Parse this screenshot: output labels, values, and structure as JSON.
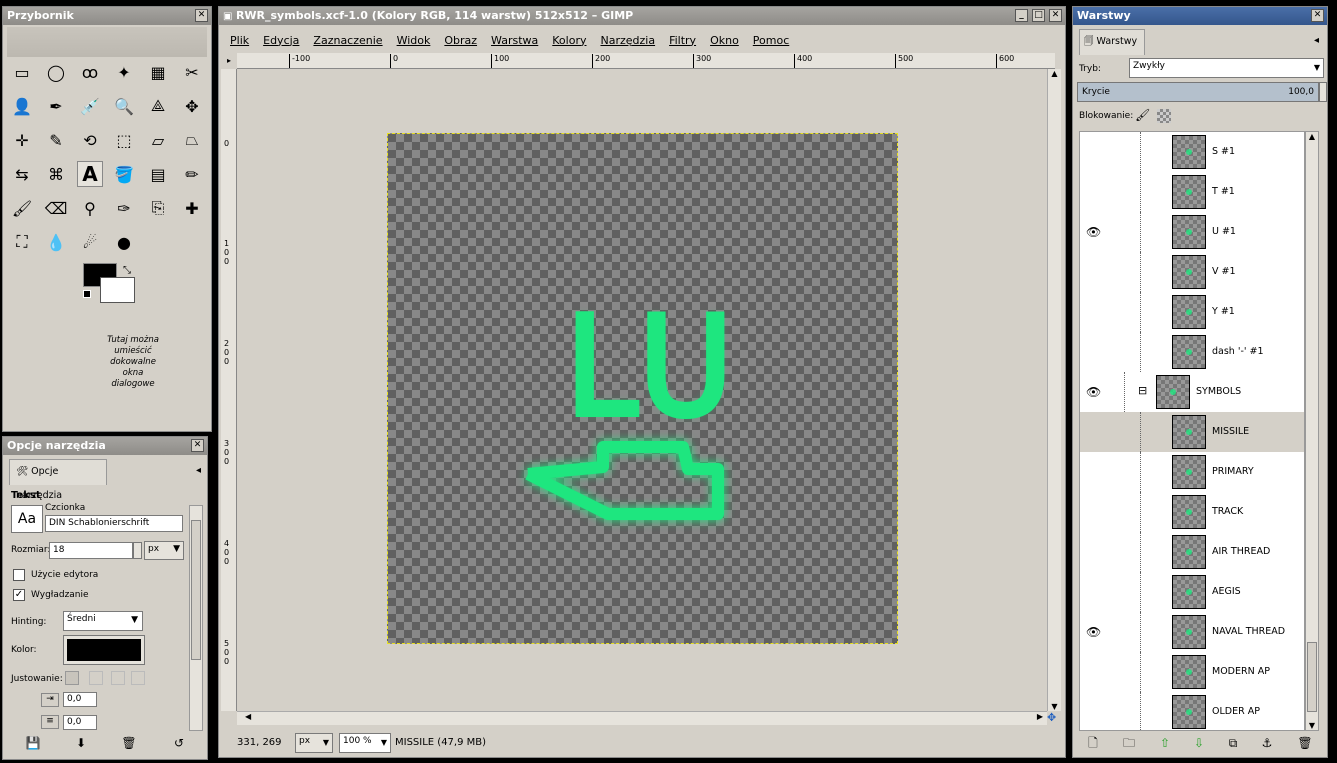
{
  "toolbox": {
    "title": "Przybornik",
    "close": "✕",
    "dock_hint": "Tutaj można umieścić dokowalne okna dialogowe"
  },
  "tool_options": {
    "title": "Opcje narzędzia",
    "tab": "Opcje narzędzia",
    "section": "Tekst",
    "font_label": "Czcionka",
    "font_value": "DIN Schablonierschrift",
    "font_preview": "Aa",
    "size_label": "Rozmiar:",
    "size_value": "18",
    "size_unit": "px",
    "editor_label": "Użycie edytora",
    "antialias_label": "Wygładzanie",
    "antialias_check": "✓",
    "hinting_label": "Hinting:",
    "hinting_value": "Średni",
    "color_label": "Kolor:",
    "justify_label": "Justowanie:",
    "indent_value": "0,0",
    "spacing_value": "0,0"
  },
  "image_window": {
    "title": "RWR_symbols.xcf-1.0 (Kolory RGB, 114 warstw) 512x512 – GIMP",
    "menu": [
      "Plik",
      "Edycja",
      "Zaznaczenie",
      "Widok",
      "Obraz",
      "Warstwa",
      "Kolory",
      "Narzędzia",
      "Filtry",
      "Okno",
      "Pomoc"
    ],
    "ruler_h": [
      "-100",
      "0",
      "100",
      "200",
      "300",
      "400",
      "500",
      "600"
    ],
    "ruler_v": [
      "0",
      "100",
      "200",
      "300",
      "400",
      "500"
    ],
    "canvas_text": "LU",
    "coords": "331, 269",
    "unit": "px",
    "zoom": "100 %",
    "status": "MISSILE (47,9 MB)"
  },
  "layers": {
    "title": "Warstwy",
    "tab": "Warstwy",
    "mode_label": "Tryb:",
    "mode_value": "Zwykły",
    "opacity_label": "Krycie",
    "opacity_value": "100,0",
    "lock_label": "Blokowanie:",
    "items": [
      {
        "name": "S #1",
        "eye": false
      },
      {
        "name": "T #1",
        "eye": false
      },
      {
        "name": "U #1",
        "eye": true
      },
      {
        "name": "V #1",
        "eye": false
      },
      {
        "name": "Y #1",
        "eye": false
      },
      {
        "name": "dash '-' #1",
        "eye": false
      },
      {
        "name": "SYMBOLS",
        "eye": true
      },
      {
        "name": "MISSILE",
        "eye": false
      },
      {
        "name": "PRIMARY",
        "eye": false
      },
      {
        "name": "TRACK",
        "eye": false
      },
      {
        "name": "AIR THREAD",
        "eye": false
      },
      {
        "name": "AEGIS",
        "eye": false
      },
      {
        "name": "NAVAL THREAD",
        "eye": true
      },
      {
        "name": "MODERN AP",
        "eye": false
      },
      {
        "name": "OLDER AP",
        "eye": false
      }
    ]
  },
  "colors": {
    "accent_green": "#1ee67f",
    "title_bar": "#9a9894",
    "panel": "#d4d0c8",
    "selected_row": "#d4d0c8"
  }
}
